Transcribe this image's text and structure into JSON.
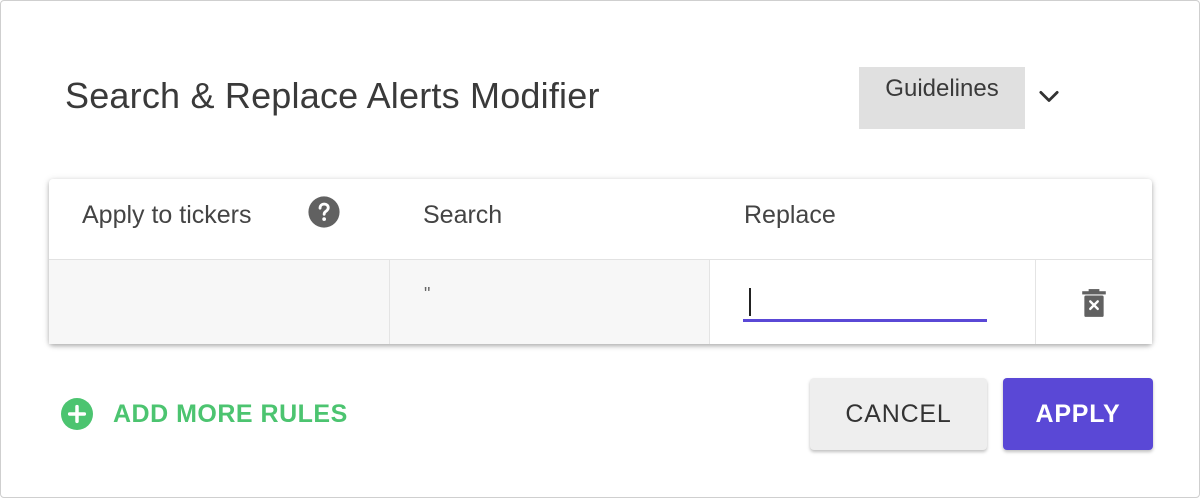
{
  "dialog": {
    "title": "Search & Replace Alerts Modifier",
    "guidelines_label": "Guidelines"
  },
  "table": {
    "headers": {
      "tickers": "Apply to tickers",
      "search": "Search",
      "replace": "Replace"
    },
    "rows": [
      {
        "tickers": "",
        "search": "\"",
        "replace": ""
      }
    ]
  },
  "footer": {
    "add_rules_label": "ADD MORE RULES",
    "cancel_label": "CANCEL",
    "apply_label": "APPLY"
  },
  "icons": {
    "help": "help-circle-icon",
    "chevron": "chevron-down-icon",
    "delete": "delete-icon",
    "add": "add-circle-icon"
  },
  "colors": {
    "accent": "#5a48d6",
    "add_green": "#4cc470",
    "guidelines_bg": "#e0e0e0"
  }
}
